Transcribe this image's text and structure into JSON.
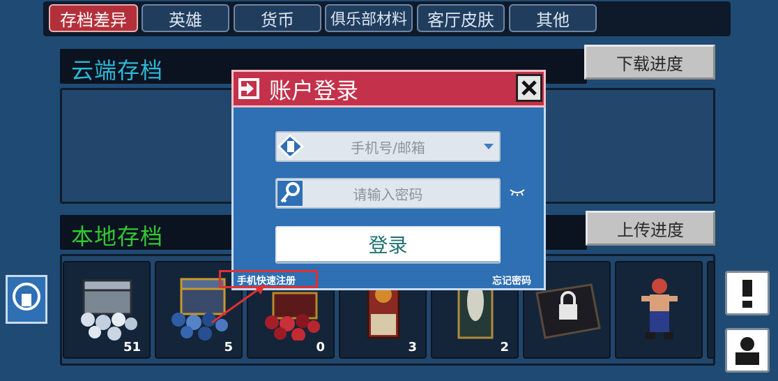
{
  "tabs": [
    {
      "label": "存档差异",
      "active": true
    },
    {
      "label": "英雄",
      "active": false
    },
    {
      "label": "货币",
      "active": false
    },
    {
      "label": "俱乐部材料",
      "active": false
    },
    {
      "label": "客厅皮肤",
      "active": false
    },
    {
      "label": "其他",
      "active": false
    }
  ],
  "cloud": {
    "title": "云端存档",
    "button": "下载进度",
    "title_color": "#2eb6d6"
  },
  "local": {
    "title": "本地存档",
    "button": "上传进度",
    "title_color": "#32c832",
    "items": [
      {
        "icon": "silver-gem-chest-icon",
        "count": "51"
      },
      {
        "icon": "blue-gem-chest-icon",
        "count": "5"
      },
      {
        "icon": "red-gem-chest-icon",
        "count": "0"
      },
      {
        "icon": "ticket-icon",
        "count": "3"
      },
      {
        "icon": "card-icon",
        "count": "2"
      },
      {
        "icon": "locked-box-icon",
        "count": ""
      },
      {
        "icon": "fighter-skin-icon",
        "count": ""
      }
    ]
  },
  "dialog": {
    "title": "账户登录",
    "account_placeholder": "手机号/邮箱",
    "password_placeholder": "请输入密码",
    "login_button": "登录",
    "register_link": "手机快速注册",
    "forgot_link": "忘记密码",
    "header_color": "#c4314a",
    "body_color": "#2f6fb3"
  }
}
